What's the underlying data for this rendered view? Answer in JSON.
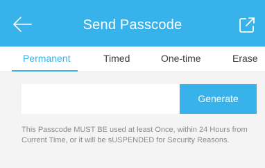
{
  "header": {
    "title": "Send Passcode",
    "back_icon": "arrow-left-icon",
    "share_icon": "share-icon",
    "color": "#37b2ea"
  },
  "tabs": [
    {
      "label": "Permanent",
      "active": true
    },
    {
      "label": "Timed",
      "active": false
    },
    {
      "label": "One-time",
      "active": false
    },
    {
      "label": "Erase",
      "active": false
    }
  ],
  "form": {
    "passcode_value": "",
    "passcode_placeholder": "",
    "generate_label": "Generate"
  },
  "hint_text": "This Passcode MUST BE used at least Once, within 24 Hours from Current Time, or it will be sUSPENDED for Security Reasons."
}
